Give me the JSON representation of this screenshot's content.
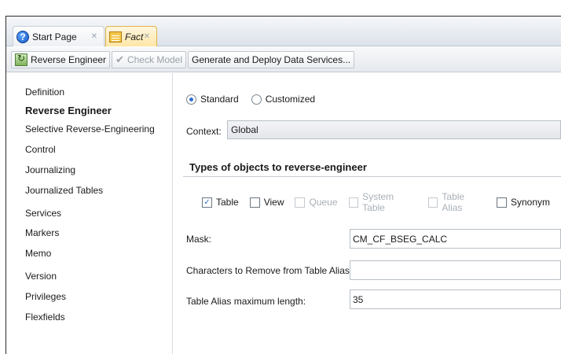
{
  "tabs": [
    {
      "label": "Start Page",
      "icon": "help-icon"
    },
    {
      "label": "Fact",
      "icon": "datastore-icon"
    }
  ],
  "toolbar": {
    "reverse_engineer": "Reverse Engineer",
    "check_model": "Check Model",
    "generate_deploy": "Generate and Deploy Data Services..."
  },
  "nav": {
    "items": [
      "Definition",
      "Reverse Engineer",
      "Selective Reverse-Engineering",
      "Control",
      "Journalizing",
      "Journalized Tables",
      "Services",
      "Markers",
      "Memo",
      "Version",
      "Privileges",
      "Flexfields"
    ],
    "active": "Reverse Engineer"
  },
  "mode": {
    "standard": "Standard",
    "customized": "Customized",
    "selected": "Standard"
  },
  "context": {
    "label": "Context:",
    "value": "Global"
  },
  "types": {
    "title": "Types of objects to reverse-engineer",
    "options": [
      {
        "label": "Table",
        "checked": true,
        "enabled": true
      },
      {
        "label": "View",
        "checked": false,
        "enabled": true
      },
      {
        "label": "Queue",
        "checked": false,
        "enabled": false
      },
      {
        "label": "System Table",
        "checked": false,
        "enabled": false
      },
      {
        "label": "Table Alias",
        "checked": false,
        "enabled": false
      },
      {
        "label": "Synonym",
        "checked": false,
        "enabled": true
      }
    ]
  },
  "fields": {
    "mask_label": "Mask:",
    "mask_value": "CM_CF_BSEG_CALC",
    "remove_chars_label": "Characters to Remove from Table Alias:",
    "remove_chars_value": "",
    "alias_max_label": "Table Alias maximum length:",
    "alias_max_value": "35"
  }
}
